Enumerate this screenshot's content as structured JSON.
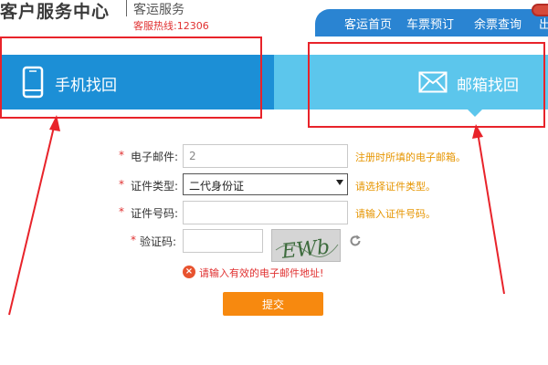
{
  "header": {
    "brand_main": "客户服务中心",
    "brand_sub": "客运服务",
    "hotline": "客服热线:12306",
    "nav": [
      {
        "label": "客运首页"
      },
      {
        "label": "车票预订"
      },
      {
        "label": "余票查询"
      },
      {
        "label": "出"
      }
    ]
  },
  "tabs": {
    "phone": {
      "label": "手机找回",
      "icon": "mobile-phone-icon"
    },
    "email": {
      "label": "邮箱找回",
      "icon": "envelope-icon"
    }
  },
  "form": {
    "email": {
      "label": "电子邮件:",
      "value": "2",
      "hint": "注册时所填的电子邮箱。"
    },
    "id_type": {
      "label": "证件类型:",
      "value": "二代身份证",
      "hint": "请选择证件类型。"
    },
    "id_number": {
      "label": "证件号码:",
      "value": "",
      "hint": "请输入证件号码。"
    },
    "captcha": {
      "label": "验证码:",
      "value": "",
      "image_text": "EWb"
    },
    "error": "请输入有效的电子邮件地址!",
    "submit_label": "提交",
    "required_mark": "*"
  },
  "colors": {
    "nav_bg": "#2a84d2",
    "tab_phone": "#1c8fd6",
    "tab_email": "#5cc6ec",
    "hint": "#e69500",
    "error": "#e03030",
    "submit": "#f7890f",
    "annotation": "#e8232a"
  }
}
